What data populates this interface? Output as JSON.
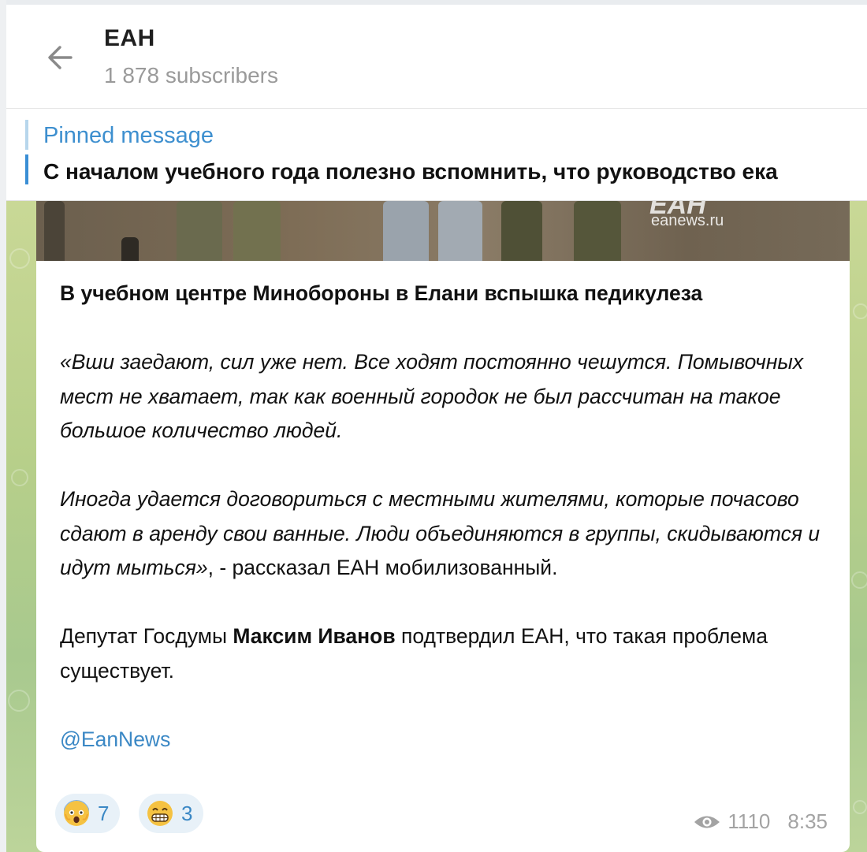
{
  "header": {
    "title": "ЕАН",
    "subtitle": "1 878 subscribers"
  },
  "pinned": {
    "label": "Pinned message",
    "text": "С началом учебного года полезно вспомнить, что руководство ека"
  },
  "photo": {
    "watermark_logo": "ЕАН",
    "watermark_url": "eanews.ru"
  },
  "message": {
    "headline": "В учебном центре Минобороны в Елани вспышка педикулеза",
    "quote1": "«Вши заедают, сил уже нет. Все ходят постоянно чешутся. Помывочных мест не хватает, так как военный городок не был рассчитан на такое большое количество людей.",
    "quote2": "Иногда удается договориться с местными жителями, которые почасово сдают в аренду свои ванные. Люди объединяются в группы, скидываются и идут мыться»",
    "quote2_tail": ", - рассказал ЕАН мобилизованный.",
    "p3_before": "Депутат Госдумы ",
    "p3_name": "Максим Иванов",
    "p3_after": " подтвердил ЕАН, что такая проблема существует.",
    "link": "@EanNews"
  },
  "reactions": [
    {
      "emoji": "shocked-face",
      "count": "7"
    },
    {
      "emoji": "grinning-face",
      "count": "3"
    }
  ],
  "meta": {
    "views": "1110",
    "time": "8:35"
  },
  "colors": {
    "accent": "#3b88c5",
    "pinned_label": "#3d8fcf",
    "reaction_bg": "#e8f1f8"
  }
}
